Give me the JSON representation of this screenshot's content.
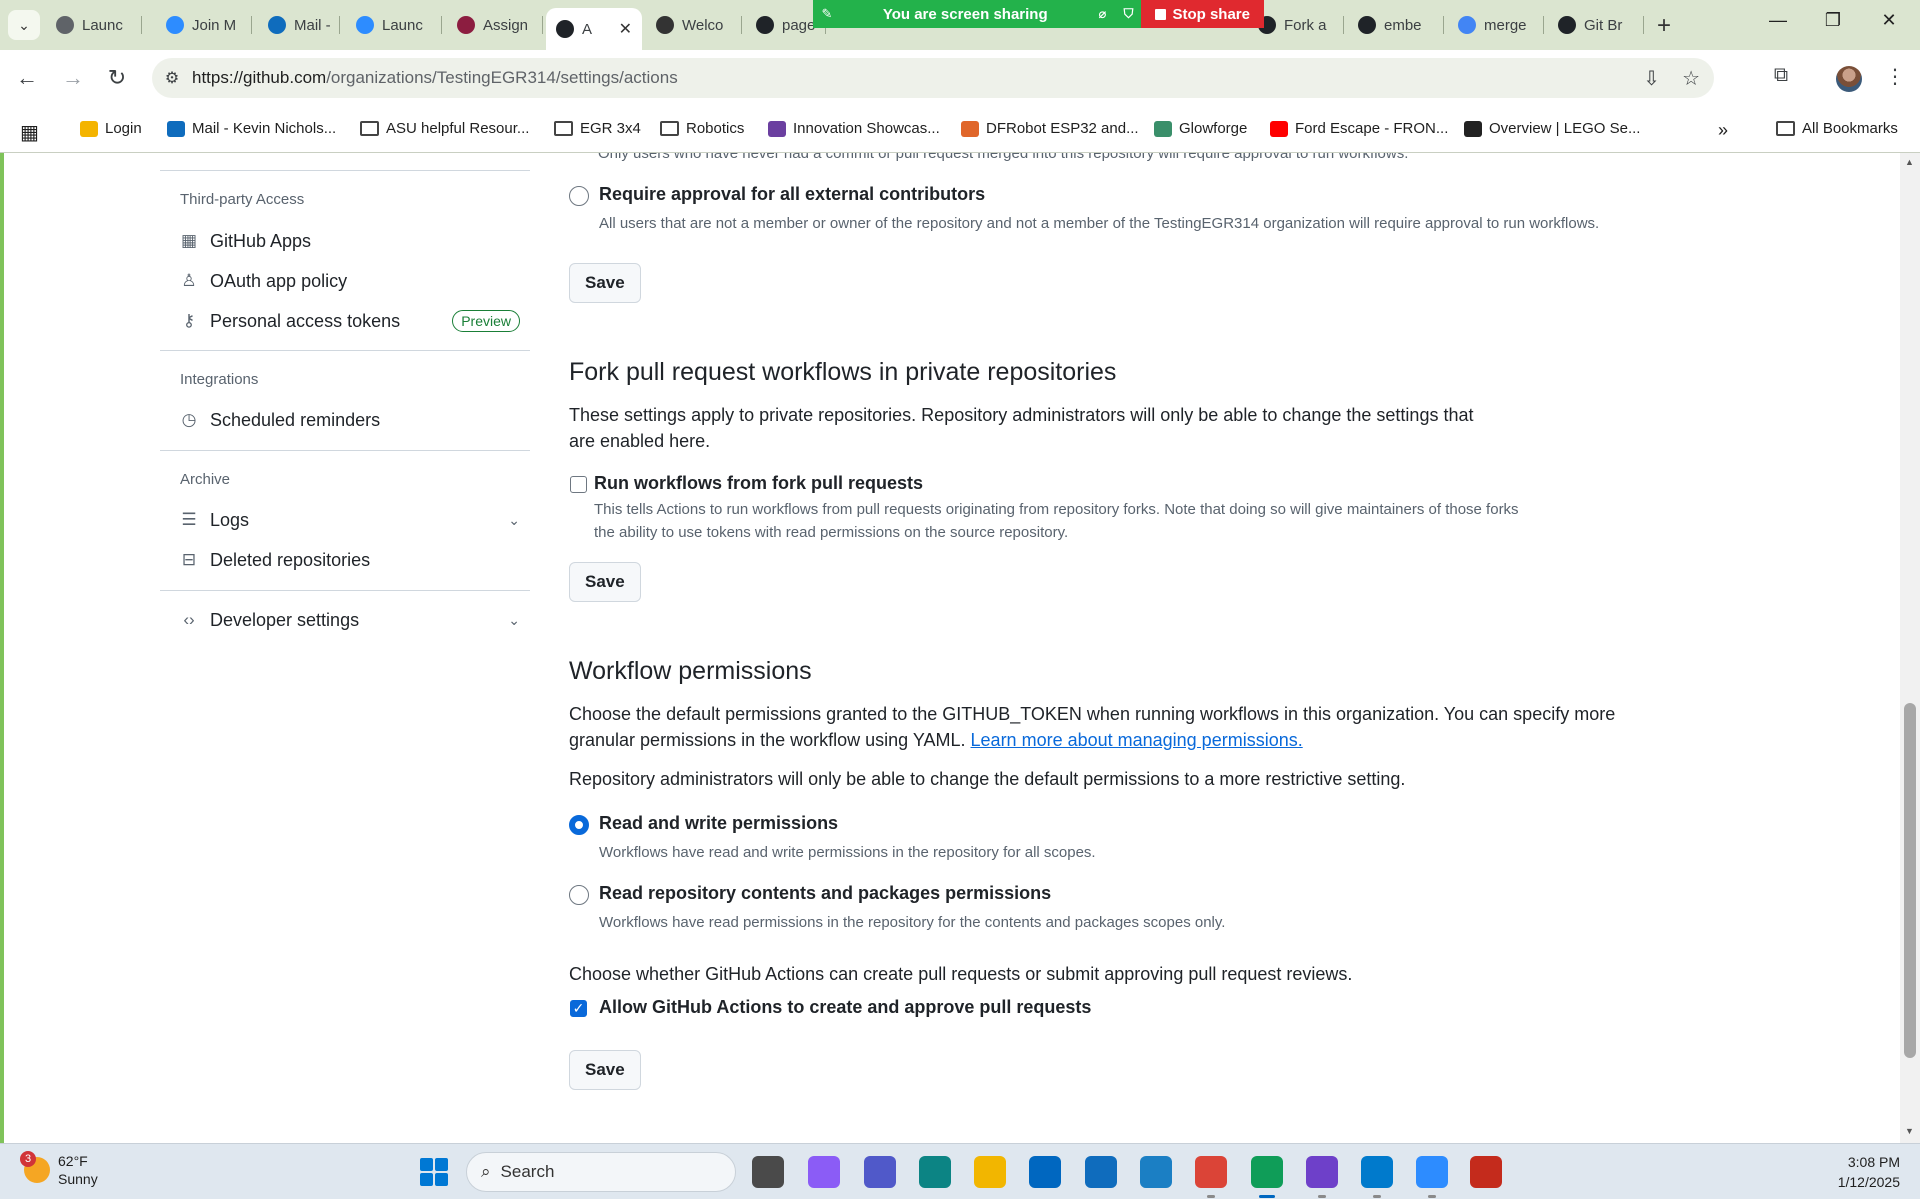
{
  "browser": {
    "tabs": [
      {
        "label": "Launc",
        "icon": "launch-icon",
        "color": "#5f6368"
      },
      {
        "label": "Join M",
        "icon": "zoom-icon",
        "color": "#2d8cff"
      },
      {
        "label": "Mail -",
        "icon": "outlook-icon",
        "color": "#0f6cbd"
      },
      {
        "label": "Launc",
        "icon": "zoom-icon",
        "color": "#2d8cff"
      },
      {
        "label": "Assign",
        "icon": "asu-icon",
        "color": "#8c1d40"
      },
      {
        "label": "A",
        "icon": "github-icon",
        "color": "#1f2328",
        "active": true
      },
      {
        "label": "Welco",
        "icon": "egr314-icon",
        "color": "#333333"
      },
      {
        "label": "page",
        "icon": "github-icon",
        "color": "#1f2328"
      },
      {
        "label": "Fork a",
        "icon": "github-icon",
        "color": "#1f2328"
      },
      {
        "label": "embe",
        "icon": "github-icon",
        "color": "#1f2328"
      },
      {
        "label": "merge",
        "icon": "google-icon",
        "color": "#4285f4"
      },
      {
        "label": "Git Br",
        "icon": "wordpress-icon",
        "color": "#1f2328"
      }
    ],
    "close_glyph": "✕",
    "share": {
      "text": "You are screen sharing",
      "stop_label": "Stop share"
    },
    "url": {
      "host": "https://github.com",
      "path": "/organizations/TestingEGR314/settings/actions"
    },
    "bookmarks": [
      {
        "label": "Login",
        "icon": "login-icon",
        "color": "#f4b400"
      },
      {
        "label": "Mail - Kevin Nichols...",
        "icon": "outlook-icon",
        "color": "#0f6cbd"
      },
      {
        "label": "ASU helpful Resour...",
        "icon": "folder-icon"
      },
      {
        "label": "EGR 3x4",
        "icon": "folder-icon"
      },
      {
        "label": "Robotics",
        "icon": "folder-icon"
      },
      {
        "label": "Innovation Showcas...",
        "icon": "list-icon",
        "color": "#6b3fa0"
      },
      {
        "label": "DFRobot ESP32 and...",
        "icon": "dfrobot-icon",
        "color": "#e0662a"
      },
      {
        "label": "Glowforge",
        "icon": "glowforge-icon",
        "color": "#3a8f6a"
      },
      {
        "label": "Ford Escape - FRON...",
        "icon": "youtube-icon",
        "color": "#ff0000"
      },
      {
        "label": "Overview | LEGO Se...",
        "icon": "star-badge-icon",
        "color": "#222222"
      }
    ],
    "all_bookmarks": "All Bookmarks"
  },
  "sidebar": {
    "third_party_heading": "Third-party Access",
    "github_apps": "GitHub Apps",
    "oauth_policy": "OAuth app policy",
    "pat": "Personal access tokens",
    "pat_badge": "Preview",
    "integrations_heading": "Integrations",
    "scheduled_reminders": "Scheduled reminders",
    "archive_heading": "Archive",
    "logs": "Logs",
    "deleted_repos": "Deleted repositories",
    "developer_settings": "Developer settings"
  },
  "main": {
    "top_cut_desc": "Only users who have never had a commit or pull request merged into this repository will require approval to run workflows.",
    "require_all_label": "Require approval for all external contributors",
    "require_all_desc": "All users that are not a member or owner of the repository and not a member of the TestingEGR314 organization will require approval to run workflows.",
    "save": "Save",
    "fork_title": "Fork pull request workflows in private repositories",
    "fork_para": "These settings apply to private repositories. Repository administrators will only be able to change the settings that are enabled here.",
    "run_fork_label": "Run workflows from fork pull requests",
    "run_fork_desc": "This tells Actions to run workflows from pull requests originating from repository forks. Note that doing so will give maintainers of those forks the ability to use tokens with read permissions on the source repository.",
    "run_fork_checked": false,
    "wp_title": "Workflow permissions",
    "wp_para": "Choose the default permissions granted to the GITHUB_TOKEN when running workflows in this organization. You can specify more granular permissions in the workflow using YAML.",
    "wp_link": "Learn more about managing permissions.",
    "wp_para2": "Repository administrators will only be able to change the default permissions to a more restrictive setting.",
    "rw_label": "Read and write permissions",
    "rw_desc": "Workflows have read and write permissions in the repository for all scopes.",
    "rw_selected": true,
    "read_label": "Read repository contents and packages permissions",
    "read_desc": "Workflows have read permissions in the repository for the contents and packages scopes only.",
    "pr_para": "Choose whether GitHub Actions can create pull requests or submit approving pull request reviews.",
    "allow_pr_label": "Allow GitHub Actions to create and approve pull requests",
    "allow_pr_checked": true
  },
  "taskbar": {
    "weather_temp": "62°F",
    "weather_desc": "Sunny",
    "weather_badge": "3",
    "search": "Search",
    "time": "3:08 PM",
    "date": "1/12/2025",
    "apps": [
      {
        "icon": "file-explorer-mini-icon",
        "color": "#4a4a4a"
      },
      {
        "icon": "copilot-icon",
        "color": "#8b5cf6"
      },
      {
        "icon": "teams-icon",
        "color": "#5059c9"
      },
      {
        "icon": "edge-icon",
        "color": "#0c8484"
      },
      {
        "icon": "folder-icon",
        "color": "#f2b600"
      },
      {
        "icon": "store-icon",
        "color": "#0067c0"
      },
      {
        "icon": "outlook-icon",
        "color": "#0f6cbd"
      },
      {
        "icon": "calculator-icon",
        "color": "#1b7fc4"
      },
      {
        "icon": "chrome-icon",
        "color": "#db4437"
      },
      {
        "icon": "chrome-profile-icon",
        "color": "#0f9d58"
      },
      {
        "icon": "github-desktop-icon",
        "color": "#6e40c9"
      },
      {
        "icon": "vscode-icon",
        "color": "#007acc"
      },
      {
        "icon": "zoom-icon",
        "color": "#2d8cff"
      },
      {
        "icon": "snipping-tool-icon",
        "color": "#c42b1c"
      }
    ]
  }
}
